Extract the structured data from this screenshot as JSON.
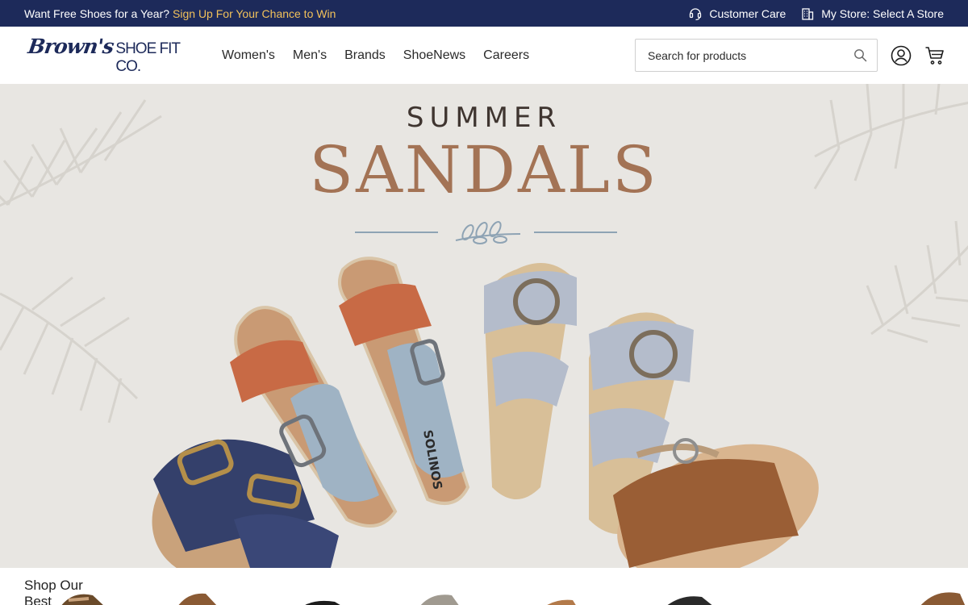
{
  "topbar": {
    "promo_text": "Want Free Shoes for a Year?",
    "promo_link": "Sign Up For Your Chance to Win",
    "customer_care": "Customer Care",
    "my_store": "My Store: Select A Store"
  },
  "header": {
    "logo_script": "Brown's",
    "logo_caps": "SHOE FIT CO.",
    "nav": [
      "Women's",
      "Men's",
      "Brands",
      "ShoeNews",
      "Careers"
    ],
    "search_placeholder": "Search for products"
  },
  "hero": {
    "kicker": "SUMMER",
    "headline": "SANDALS",
    "shoe_brand_text": "SOLINOS"
  },
  "bottom": {
    "title": "Shop Our Best"
  },
  "colors": {
    "topbar_bg": "#1d2a5a",
    "promo_accent": "#f1c15a",
    "brand_navy": "#1d2a5a",
    "headline_tan": "#a37355"
  },
  "icons": [
    "headset-icon",
    "store-building-icon",
    "search-icon",
    "account-icon",
    "cart-icon",
    "leaf-sprig-icon"
  ]
}
